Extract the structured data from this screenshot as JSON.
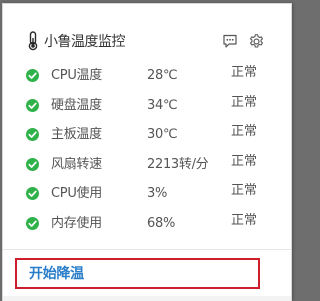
{
  "app": {
    "title": "小鲁温度监控",
    "icons": [
      "thermometer-icon",
      "message-icon",
      "gear-icon"
    ]
  },
  "metrics": [
    {
      "label": "CPU温度",
      "value": "28℃",
      "status": "正常"
    },
    {
      "label": "硬盘温度",
      "value": "34℃",
      "status": "正常"
    },
    {
      "label": "主板温度",
      "value": "30℃",
      "status": "正常"
    },
    {
      "label": "风扇转速",
      "value": "2213转/分",
      "status": "正常"
    },
    {
      "label": "CPU使用",
      "value": "3%",
      "status": "正常"
    },
    {
      "label": "内存使用",
      "value": "68%",
      "status": "正常"
    }
  ],
  "actions": {
    "cool_down_label": "开始降温"
  },
  "colors": {
    "check_green": "#2fb24a",
    "accent_blue": "#2a7dc9",
    "highlight_red": "#cc1f2b"
  }
}
